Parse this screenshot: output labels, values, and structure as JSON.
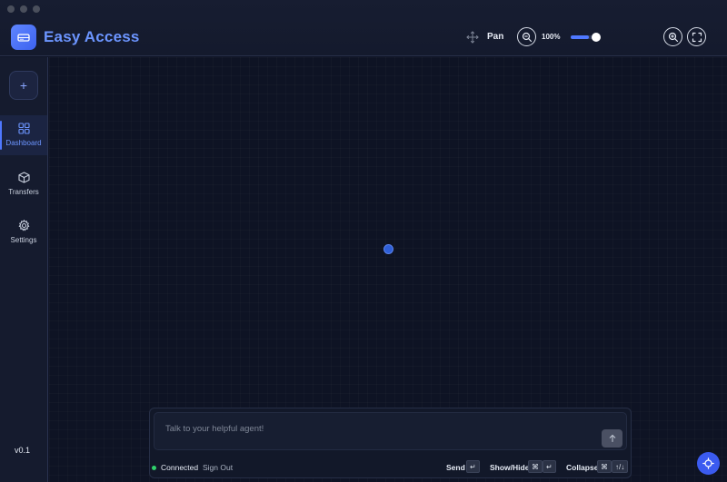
{
  "app": {
    "title": "Easy Access",
    "version": "v0.1"
  },
  "toolbar": {
    "tool_label": "Pan",
    "zoom_level": "100%",
    "zoom_fraction": 0.62
  },
  "sidebar": {
    "add_label": "+",
    "items": [
      {
        "label": "Dashboard",
        "icon": "grid-icon",
        "active": true
      },
      {
        "label": "Transfers",
        "icon": "box-icon",
        "active": false
      },
      {
        "label": "Settings",
        "icon": "gear-icon",
        "active": false
      }
    ]
  },
  "chat": {
    "placeholder": "Talk to your helpful agent!",
    "status": "Connected",
    "sign_out": "Sign Out",
    "shortcuts": {
      "send_label": "Send",
      "send_key": "↵",
      "showhide_label": "Show/Hide",
      "showhide_mod": "⌘",
      "showhide_key": "↵",
      "collapse_label": "Collapse",
      "collapse_mod": "⌘",
      "collapse_key": "↑/↓"
    }
  },
  "colors": {
    "accent": "#4f78ff",
    "title": "#6c95ff",
    "status_online": "#2fd16b",
    "background": "#0e1324"
  }
}
